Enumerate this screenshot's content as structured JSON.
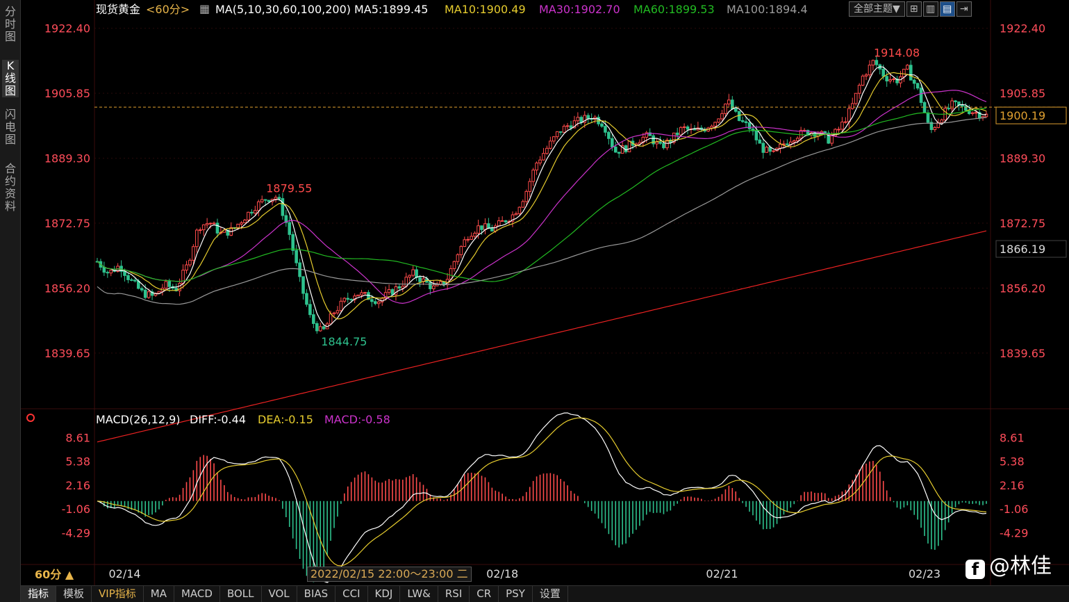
{
  "side_tabs": [
    "分\n时\n图",
    "K\n线\n图",
    "闪\n电\n图",
    "合\n约\n资\n料"
  ],
  "header": {
    "symbol": "现货黄金",
    "period_tag": "<60分>",
    "ma_params": "MA(5,10,30,60,100,200)",
    "ma5_label": "MA5:1899.45",
    "ma10_label": "MA10:1900.49",
    "ma30_label": "MA30:1902.70",
    "ma60_label": "MA60:1899.53",
    "ma100_label": "MA100:1894.4"
  },
  "toolbar": {
    "theme_label": "全部主题▼",
    "icons": [
      "grid-icon",
      "layout-icon",
      "chart-icon",
      "exit-icon"
    ],
    "icon_glyphs": [
      "⊞",
      "▥",
      "▤",
      "⇥"
    ]
  },
  "colors": {
    "up": "#ff4b4b",
    "down": "#2ec28e",
    "ma5": "#ffffff",
    "ma10": "#e6cc2e",
    "ma30": "#cc33cc",
    "ma60": "#22bb22",
    "ma100": "#9a9a9a",
    "ma200": "#ee2222",
    "axis_text": "#ff4d5a",
    "grid": "#2a0a0a",
    "current_price_line": "#e0a030"
  },
  "chart_data": [
    {
      "type": "candlestick",
      "title": "现货黄金 <60分>",
      "x_labels": [
        "02/14",
        "02/18",
        "02/21",
        "02/23"
      ],
      "y_ticks": [
        "1922.40",
        "1905.85",
        "1889.30",
        "1872.75",
        "1856.20",
        "1839.65"
      ],
      "ylim": [
        1826,
        1925
      ],
      "annotations": {
        "high_label": "1914.08",
        "local_high_label": "1879.55",
        "low_label": "1844.75",
        "current_price": "1900.19",
        "right_box_price": "1866.19"
      },
      "price_path": [
        1863,
        1860,
        1862,
        1858,
        1855,
        1854,
        1857,
        1856,
        1862,
        1872,
        1873,
        1870,
        1871,
        1874,
        1877,
        1879,
        1879.55,
        1871,
        1858,
        1848,
        1844.75,
        1850,
        1853,
        1855,
        1854,
        1853,
        1855,
        1857,
        1860,
        1858,
        1856,
        1858,
        1865,
        1870,
        1872,
        1871,
        1873,
        1875,
        1880,
        1888,
        1892,
        1896,
        1898,
        1899,
        1900,
        1898,
        1891,
        1892,
        1894,
        1895,
        1892,
        1894,
        1897,
        1896,
        1897,
        1899,
        1904,
        1899,
        1897,
        1892,
        1890,
        1893,
        1895,
        1896,
        1896,
        1894,
        1897,
        1902,
        1910,
        1914.08,
        1910,
        1909,
        1912,
        1906,
        1896,
        1900,
        1903,
        1902,
        1901,
        1900.19
      ],
      "ma_labels": [
        "MA5",
        "MA10",
        "MA30",
        "MA60",
        "MA100",
        "MA200"
      ]
    },
    {
      "type": "macd",
      "title": "MACD(26,12,9)",
      "diff_label": "DIFF:-0.44",
      "dea_label": "DEA:-0.15",
      "macd_label": "MACD:-0.58",
      "y_ticks": [
        "8.61",
        "5.38",
        "2.16",
        "-1.06",
        "-4.29"
      ],
      "ylim": [
        -7,
        9.5
      ],
      "period_label": "60分 ▲",
      "cursor_time": "2022/02/15 22:00～23:00 二"
    }
  ],
  "bottom_bar": [
    "指标",
    "模板",
    "VIP指标",
    "MA",
    "MACD",
    "BOLL",
    "VOL",
    "BIAS",
    "CCI",
    "KDJ",
    "LW&",
    "RSI",
    "CR",
    "PSY",
    "设置"
  ],
  "watermark": {
    "logo": "f",
    "text": "@林佳"
  }
}
